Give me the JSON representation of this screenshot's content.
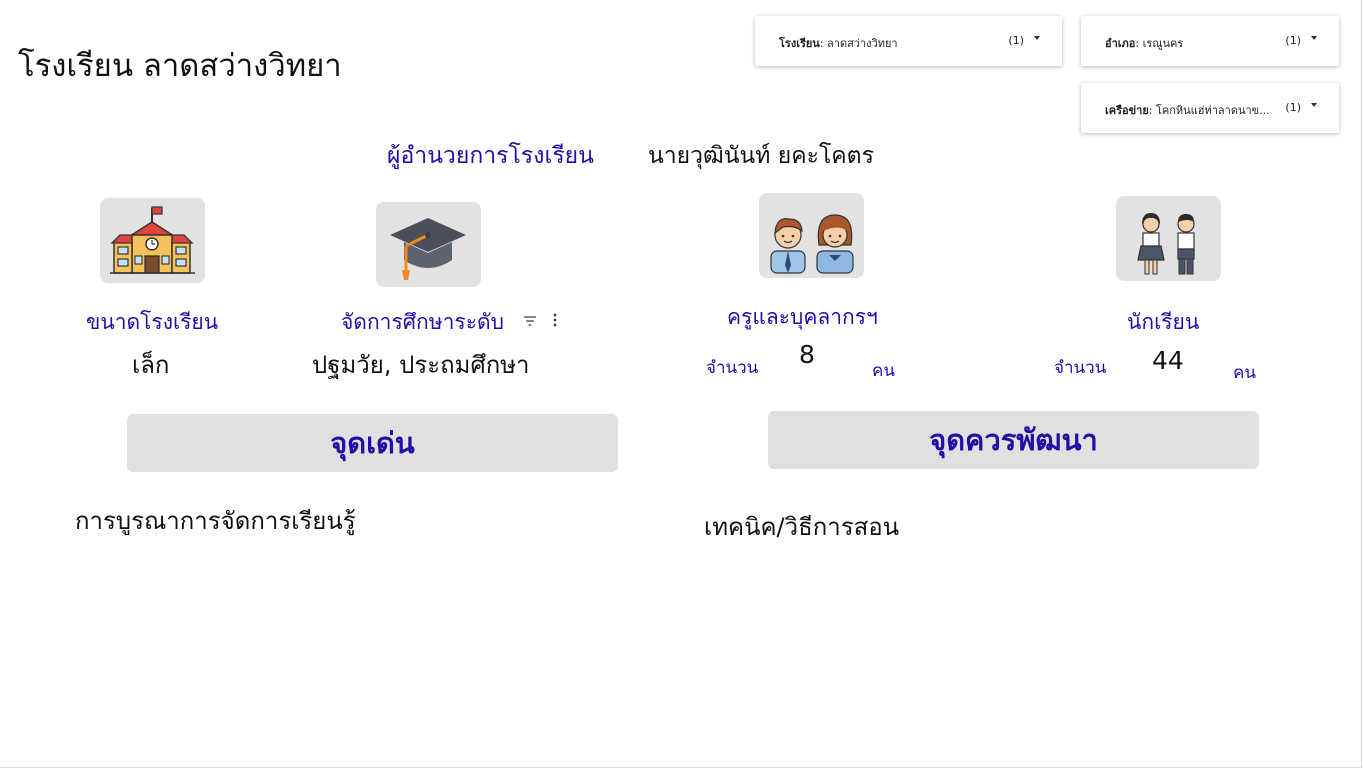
{
  "page": {
    "school_title": "โรงเรียน ลาดสว่างวิทยา"
  },
  "filters": [
    {
      "key": "โรงเรียน",
      "value": "ลาดสว่างวิทยา",
      "count": "(1)"
    },
    {
      "key": "อำเภอ",
      "value": "เรณูนคร",
      "count": "(1)"
    },
    {
      "key": "เครือข่าย",
      "value": "โคกหินแฮ่ท่าลาดนาข...",
      "count": "(1)"
    }
  ],
  "director": {
    "label": "ผู้อำนวยการโรงเรียน",
    "name": "นายวุฒินันท์ ยคะโคตร"
  },
  "cards": {
    "school_size": {
      "label": "ขนาดโรงเรียน",
      "value": "เล็ก",
      "icon": "school-building-icon"
    },
    "education_level": {
      "label": "จัดการศึกษาระดับ",
      "value": "ปฐมวัย, ประถมศึกษา",
      "icon": "graduation-cap-icon"
    },
    "staff": {
      "label": "ครูและบุคลากรฯ",
      "count_label": "จำนวน",
      "count": "8",
      "unit": "คน",
      "icon": "teachers-icon"
    },
    "students": {
      "label": "นักเรียน",
      "count_label": "จำนวน",
      "count": "44",
      "unit": "คน",
      "icon": "students-icon"
    }
  },
  "sections": {
    "strengths": {
      "title": "จุดเด่น",
      "text": "การบูรณาการจัดการเรียนรู้"
    },
    "improvements": {
      "title": "จุดควรพัฒนา",
      "text": "เทคนิค/วิธีการสอน"
    }
  },
  "colors": {
    "accent": "#1f0fa8",
    "tile_bg": "#e2e2e2",
    "section_bg": "#e0e0e0"
  }
}
